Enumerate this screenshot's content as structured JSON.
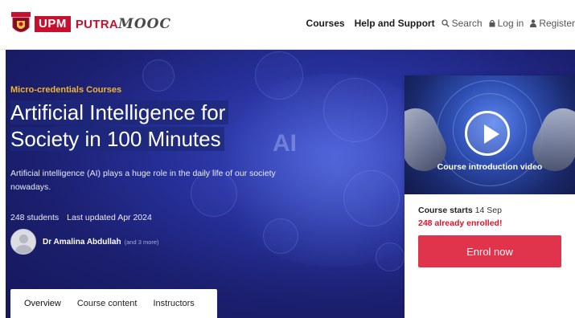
{
  "header": {
    "brand_upm": "UPM",
    "brand_putra": "PUTRA",
    "brand_mooc": "MOOC",
    "nav": {
      "courses": "Courses",
      "help": "Help and Support",
      "search": "Search",
      "login": "Log in",
      "register": "Register"
    }
  },
  "hero": {
    "category": "Micro-credentials Courses",
    "title_line1": "Artificial Intelligence for",
    "title_line2": "Society in 100 Minutes",
    "description": "Artificial intelligence (AI) plays a huge role in the daily life of our society nowadays.",
    "students": "248 students",
    "updated": "Last updated Apr 2024",
    "author_name": "Dr Amalina Abdullah",
    "author_more": "(and 3 more)",
    "ai_text": "AI"
  },
  "tabs": [
    "Overview",
    "Course content",
    "Instructors"
  ],
  "sidecard": {
    "video_label": "Course introduction video",
    "starts_label": "Course starts",
    "starts_date": "14 Sep",
    "enrolled": "248 already enrolled!",
    "enrol_button": "Enrol now"
  },
  "colors": {
    "brand_red": "#c8102e",
    "category_gold": "#f2b531",
    "hero_blue": "#26309a",
    "enrol_button": "#e0344d",
    "enrolled_text": "#e1112e"
  },
  "icons": {
    "search": "search-icon",
    "login": "lock-icon",
    "register": "user-icon",
    "play": "play-icon"
  }
}
